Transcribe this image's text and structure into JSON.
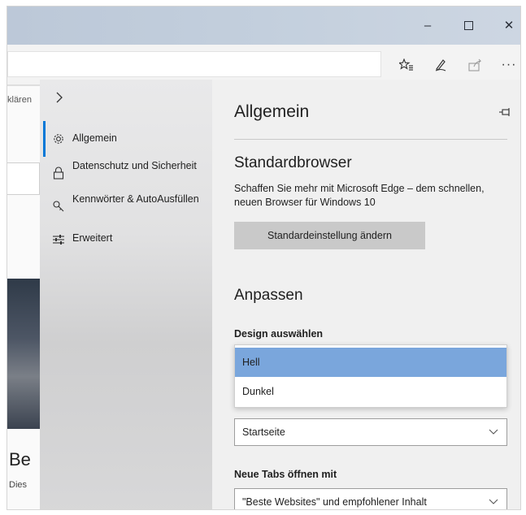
{
  "window": {
    "title_buttons": {
      "minimize": "–",
      "maximize": "",
      "close": "✕"
    }
  },
  "toolbar": {
    "more": "···"
  },
  "page": {
    "text_top": "klären",
    "heading": "Be",
    "subtext": "Dies"
  },
  "nav": {
    "items": [
      {
        "label": "Allgemein",
        "icon": "gear-icon",
        "active": true
      },
      {
        "label": "Datenschutz und Sicherheit",
        "icon": "lock-icon",
        "active": false
      },
      {
        "label": "Kennwörter & AutoAusfüllen",
        "icon": "key-icon",
        "active": false
      },
      {
        "label": "Erweitert",
        "icon": "sliders-icon",
        "active": false
      }
    ]
  },
  "panel": {
    "title": "Allgemein",
    "default_browser": {
      "heading": "Standardbrowser",
      "description": "Schaffen Sie mehr mit Microsoft Edge – dem schnellen, neuen Browser für Windows 10",
      "button": "Standardeinstellung ändern"
    },
    "customize": {
      "heading": "Anpassen",
      "design_label": "Design auswählen",
      "design_options": [
        "Hell",
        "Dunkel"
      ],
      "design_selected": "Hell",
      "start_value": "Startseite",
      "newtabs_label": "Neue Tabs öffnen mit",
      "newtabs_value": "\"Beste Websites\" und empfohlener Inhalt"
    }
  },
  "colors": {
    "accent": "#0078d7",
    "dropdown_selected": "#7aa6dc"
  }
}
